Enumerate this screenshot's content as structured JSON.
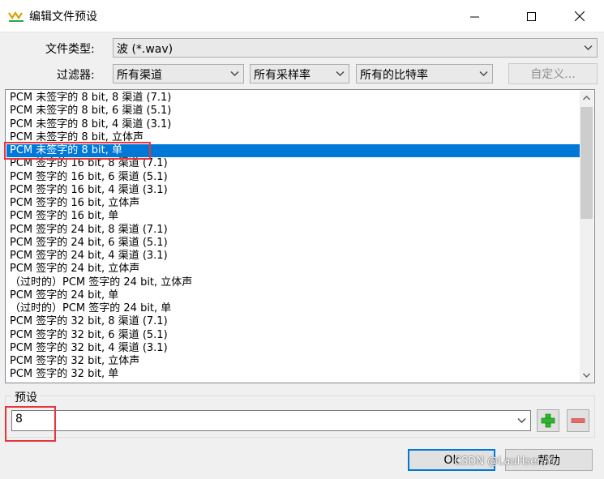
{
  "window": {
    "title": "编辑文件预设"
  },
  "file_type": {
    "label": "文件类型:",
    "value": "波 (*.wav)"
  },
  "filters": {
    "label": "过滤器:",
    "channels": "所有渠道",
    "sample_rate": "所有采样率",
    "bit_rate": "所有的比特率",
    "custom_button": "自定义..."
  },
  "format_list": {
    "items": [
      "PCM 未签字的 8 bit, 8 渠道 (7.1)",
      "PCM 未签字的 8 bit, 6 渠道 (5.1)",
      "PCM 未签字的 8 bit, 4 渠道 (3.1)",
      "PCM 未签字的 8 bit, 立体声",
      "PCM 未签字的 8 bit, 单",
      "PCM 签字的 16 bit, 8 渠道 (7.1)",
      "PCM 签字的 16 bit, 6 渠道 (5.1)",
      "PCM 签字的 16 bit, 4 渠道 (3.1)",
      "PCM 签字的 16 bit, 立体声",
      "PCM 签字的 16 bit, 单",
      "PCM 签字的 24 bit, 8 渠道 (7.1)",
      "PCM 签字的 24 bit, 6 渠道 (5.1)",
      "PCM 签字的 24 bit, 4 渠道 (3.1)",
      "PCM 签字的 24 bit, 立体声",
      "（过时的）PCM 签字的 24 bit, 立体声",
      "PCM 签字的 24 bit, 单",
      "（过时的）PCM 签字的 24 bit, 单",
      "PCM 签字的 32 bit, 8 渠道 (7.1)",
      "PCM 签字的 32 bit, 6 渠道 (5.1)",
      "PCM 签字的 32 bit, 4 渠道 (3.1)",
      "PCM 签字的 32 bit, 立体声",
      "PCM 签字的 32 bit, 单"
    ],
    "selected_index": 4
  },
  "preset": {
    "label": "预设",
    "value": "8"
  },
  "buttons": {
    "ok": "Ok",
    "help": "帮助"
  },
  "watermark": "CSDN @LauHsen-Yi",
  "colors": {
    "selection": "#0078d7",
    "highlight_box": "#e8343b",
    "add_icon": "#2db52d",
    "remove_icon": "#e06c6c"
  }
}
